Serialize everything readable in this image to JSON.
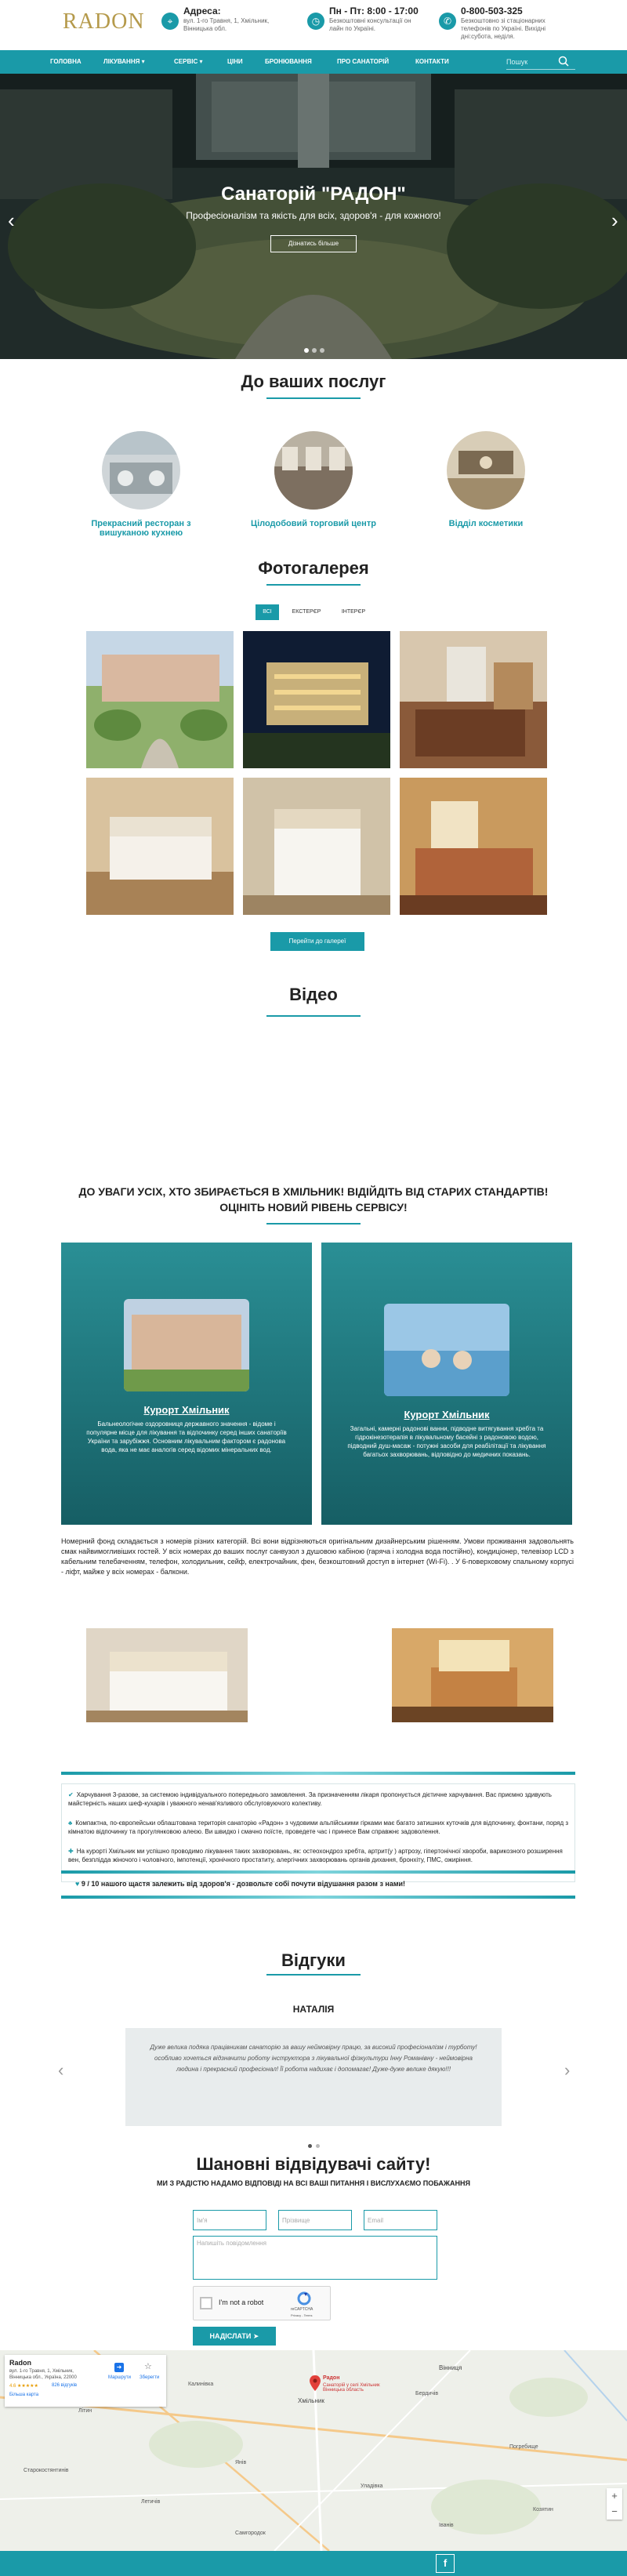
{
  "header": {
    "logo_text": "RADON",
    "address": {
      "title": "Адреса:",
      "lines": [
        "вул. 1-го Травня, 1, Хмільник,",
        "Вінницька обл."
      ]
    },
    "hours": {
      "title": "Пн - Пт: 8:00 - 17:00",
      "lines": [
        "Безкоштовні консультації он",
        "лайн по Україні."
      ]
    },
    "phone": {
      "title": "0-800-503-325",
      "lines": [
        "Безкоштовно зі стаціонарних",
        "телефонів по Україні. Вихідні",
        "дні:субота, неділя."
      ]
    }
  },
  "nav": {
    "items": [
      "Головна",
      "Лікування ▾",
      "Сервіс ▾",
      "Ціни",
      "Бронювання",
      "Про санаторій",
      "Контакти"
    ],
    "search_placeholder": "Пошук"
  },
  "hero": {
    "title": "Санаторій \"РАДОН\"",
    "subtitle": "Професіоналізм та якість для всіх, здоров'я - для кожного!",
    "button": "Дізнатись більше"
  },
  "services": {
    "title": "До ваших послуг",
    "items": [
      "Прекрасний ресторан з вишуканою кухнею",
      "Цілодобовий торговий центр",
      "Відділ косметики"
    ]
  },
  "gallery": {
    "title": "Фотогалерея",
    "tabs": [
      "ВСІ",
      "ЕКСТЕРЄР",
      "ІНТЕРЄР"
    ],
    "active_tab": "ВСІ",
    "button": "Перейти до галереї"
  },
  "video": {
    "title": "Відео"
  },
  "banner": {
    "text": "ДО УВАГИ УСІХ, ХТО ЗБИРАЄТЬСЯ В ХМІЛЬНИК! ВІДІЙДІТЬ ВІД СТАРИХ СТАНДАРТІВ! ОЦІНІТЬ НОВИЙ РІВЕНЬ СЕРВІСУ!"
  },
  "cards": [
    {
      "title": "Курорт Хмільник",
      "text": "Бальнеологічне оздоровниця державного значення - відоме і популярне місце для лікування та відпочинку серед інших санаторіїв України та зарубіжжя. Основним лікувальним фактором є радонова вода, яка не має аналогів серед відомих мінеральних вод."
    },
    {
      "title": "Курорт Хмільник",
      "text": "Загальні, камерні радонові ванни, підводне витягування хребта та гідрокінезотерапія в лікувальному басейні з радоновою водою, підводний душ-масаж - потужні засоби для реабілітації та лікування багатьох захворювань, відповідно до медичних показань."
    }
  ],
  "rooms_text": "Номерний фонд складається з номерів різних категорій. Всі вони відрізняються оригінальним дизайнерським рішенням. Умови проживання задовольнять смак найвимогливіших гостей. У всіх номерах до ваших послуг санвузол з душовою кабіною (гаряча і холодна вода постійно), кондиціонер, телевізор LCD з кабельним телебаченням, телефон, холодильник, сейф, електрочайник, фен, безкоштовний доступ в інтернет (Wi-Fi). . У 6-поверховому спальному корпусі - ліфт, майже у всіх номерах - балкони.",
  "features": [
    "Харчування 3-разове, за системою індивідуального попереднього замовлення. За призначенням лікаря пропонується дієтичне харчування. Вас приємно здивують майстерність наших шеф-кухарів і уважного ненав'язливого обслуговуючого колективу.",
    "Компактна, по-європейськи облаштована територія санаторію «Радон» з чудовими альпійськими гірками має багато затишних куточків для відпочинку, фонтани, поряд з кімнатою відпочинку та прогулянковою алеєю. Ви швидко і смачно поїсте, проведете час і принесе Вам справжнє задоволення.",
    "На курорті Хмільник ми успішно проводимо лікування таких захворювань, як: остеохондроз хребта, артрит(у ) артрозу, гіпертонічної хвороби, варикозного розширення вен, безплідда жіночого і чоловічого, імпотенції, хронічного простатиту, алергічних захворювань органів дихання, бронхіту, ПМС, ожиріння."
  ],
  "quote": "9 / 10 нашого щастя залежить від здоров'я - дозвольте собі почути відушання разом з нами!",
  "reviews": {
    "title": "Відгуки",
    "name": "НАТАЛІЯ",
    "text": "Дуже велика подяка працівникам санаторію за вашу неймовірну працю, за високий професіоналізм і турботу! особливо хочеться відзначити роботу інструктора з лікувальної фізкультури Інну Романівну - неймовірна людина і прекрасний професіонал! Її робота надихає і допомагає! Дуже-дуже велике дякую!!!"
  },
  "form": {
    "title": "Шановні відвідувачі сайту!",
    "subtitle": "МИ З РАДІСТЮ НАДАМО ВІДПОВІДІ НА ВСІ ВАШІ ПИТАННЯ І ВИСЛУХАЄМО ПОБАЖАННЯ",
    "placeholders": [
      "Ім'я",
      "Прізвище",
      "Email"
    ],
    "message_placeholder": "Напишіть повідомлення",
    "captcha_label": "I'm not a robot",
    "captcha_brand": "reCAPTCHA",
    "captcha_terms": "Privacy - Terms",
    "submit": "НАДІСЛАТИ ➤"
  },
  "map": {
    "card_title": "Radon",
    "card_address": "вул. 1-го Травня, 1, Хмільник, Вінницька обл., Україна, 22000",
    "card_rating": "4.6 ★★★★★",
    "card_reviews": "826 відгуків",
    "card_link": "Більша карта",
    "directions": "Маршрути",
    "save": "Зберегти",
    "pin_label": "Радон",
    "pin_sublabel": "Санаторій у селі Хмільник Вінницька область",
    "towns": [
      "Вінниця",
      "Хмільник",
      "Козятин",
      "Калинівка",
      "Літин",
      "Бердичів",
      "Старокостянтинів",
      "Летичів",
      "Янів",
      "Уладівка",
      "Погребище",
      "Іванів",
      "Самгородок"
    ]
  },
  "footer": {
    "fb": "f"
  }
}
